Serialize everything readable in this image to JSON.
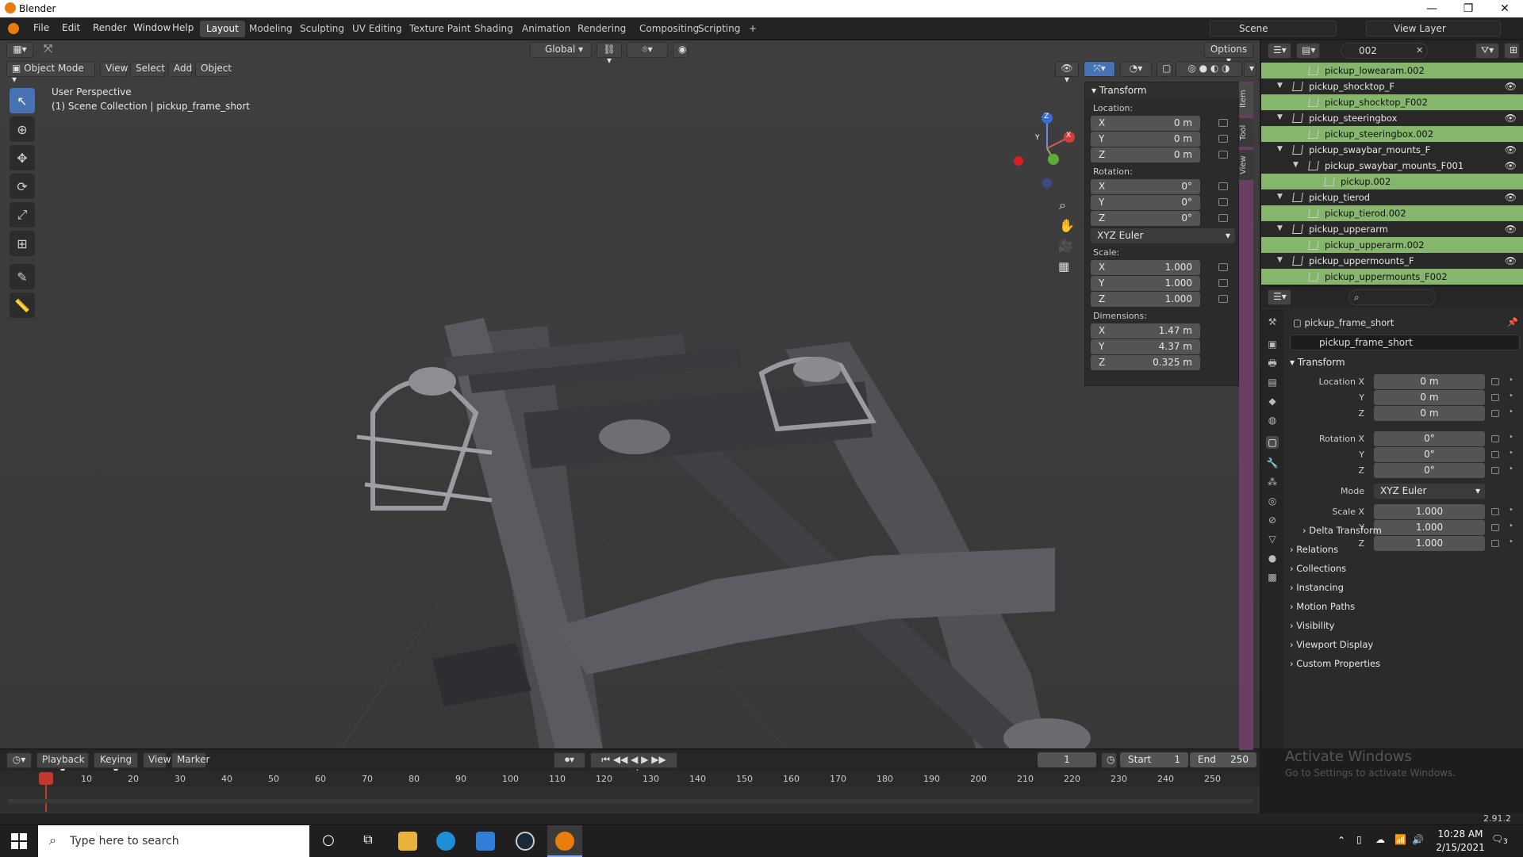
{
  "window": {
    "title": "Blender",
    "min": "—",
    "max": "❐",
    "close": "✕"
  },
  "menu": [
    "File",
    "Edit",
    "Render",
    "Window",
    "Help"
  ],
  "workspaces": [
    "Layout",
    "Modeling",
    "Sculpting",
    "UV Editing",
    "Texture Paint",
    "Shading",
    "Animation",
    "Rendering",
    "Compositing",
    "Scripting"
  ],
  "active_workspace": "Layout",
  "add_tab": "+",
  "scene": {
    "name": "Scene",
    "view_layer": "View Layer"
  },
  "viewport": {
    "transform_orientation": "Global",
    "options": "Options",
    "mode": "Object Mode",
    "header_menus": [
      "View",
      "Select",
      "Add",
      "Object"
    ],
    "overlay_line1": "User Perspective",
    "overlay_line2": "(1) Scene Collection | pickup_frame_short",
    "gizmo": {
      "x": "X",
      "y": "Y",
      "z": "Z"
    }
  },
  "npanel": {
    "title": "Transform",
    "location_label": "Location:",
    "location": [
      {
        "ax": "X",
        "v": "0 m"
      },
      {
        "ax": "Y",
        "v": "0 m"
      },
      {
        "ax": "Z",
        "v": "0 m"
      }
    ],
    "rotation_label": "Rotation:",
    "rotation": [
      {
        "ax": "X",
        "v": "0°"
      },
      {
        "ax": "Y",
        "v": "0°"
      },
      {
        "ax": "Z",
        "v": "0°"
      }
    ],
    "rotation_mode": "XYZ Euler",
    "scale_label": "Scale:",
    "scale": [
      {
        "ax": "X",
        "v": "1.000"
      },
      {
        "ax": "Y",
        "v": "1.000"
      },
      {
        "ax": "Z",
        "v": "1.000"
      }
    ],
    "dimensions_label": "Dimensions:",
    "dimensions": [
      {
        "ax": "X",
        "v": "1.47 m"
      },
      {
        "ax": "Y",
        "v": "4.37 m"
      },
      {
        "ax": "Z",
        "v": "0.325 m"
      }
    ],
    "tabs": [
      "Item",
      "Tool",
      "View"
    ]
  },
  "outliner": {
    "search": "002",
    "rows": [
      {
        "name": "pickup_lowearam.002",
        "child": true,
        "indent": 1
      },
      {
        "name": "pickup_shocktop_F",
        "child": false,
        "indent": 0
      },
      {
        "name": "pickup_shocktop_F002",
        "child": true,
        "indent": 1
      },
      {
        "name": "pickup_steeringbox",
        "child": false,
        "indent": 0
      },
      {
        "name": "pickup_steeringbox.002",
        "child": true,
        "indent": 1
      },
      {
        "name": "pickup_swaybar_mounts_F",
        "child": false,
        "indent": 0
      },
      {
        "name": "pickup_swaybar_mounts_F001",
        "child": false,
        "indent": 1
      },
      {
        "name": "pickup.002",
        "child": true,
        "indent": 2
      },
      {
        "name": "pickup_tierod",
        "child": false,
        "indent": 0
      },
      {
        "name": "pickup_tierod.002",
        "child": true,
        "indent": 1
      },
      {
        "name": "pickup_upperarm",
        "child": false,
        "indent": 0
      },
      {
        "name": "pickup_upperarm.002",
        "child": true,
        "indent": 1
      },
      {
        "name": "pickup_uppermounts_F",
        "child": false,
        "indent": 0
      },
      {
        "name": "pickup_uppermounts_F002",
        "child": true,
        "indent": 1
      }
    ]
  },
  "properties": {
    "object_name": "pickup_frame_short",
    "datablock": "pickup_frame_short",
    "transform_title": "Transform",
    "location": [
      {
        "l": "Location X",
        "v": "0 m"
      },
      {
        "l": "Y",
        "v": "0 m"
      },
      {
        "l": "Z",
        "v": "0 m"
      }
    ],
    "rotation": [
      {
        "l": "Rotation X",
        "v": "0°"
      },
      {
        "l": "Y",
        "v": "0°"
      },
      {
        "l": "Z",
        "v": "0°"
      }
    ],
    "mode_label": "Mode",
    "mode": "XYZ Euler",
    "scale": [
      {
        "l": "Scale X",
        "v": "1.000"
      },
      {
        "l": "Y",
        "v": "1.000"
      },
      {
        "l": "Z",
        "v": "1.000"
      }
    ],
    "delta": "Delta Transform",
    "sections": [
      "Relations",
      "Collections",
      "Instancing",
      "Motion Paths",
      "Visibility",
      "Viewport Display",
      "Custom Properties"
    ],
    "watermark1": "Activate Windows",
    "watermark2": "Go to Settings to activate Windows."
  },
  "timeline": {
    "menus": [
      "Playback",
      "Keying",
      "View",
      "Marker"
    ],
    "current_frame": "1",
    "start_label": "Start",
    "start": "1",
    "end_label": "End",
    "end": "250",
    "ticks": [
      "1",
      "10",
      "20",
      "30",
      "40",
      "50",
      "60",
      "70",
      "80",
      "90",
      "100",
      "110",
      "120",
      "130",
      "140",
      "150",
      "160",
      "170",
      "180",
      "190",
      "200",
      "210",
      "220",
      "230",
      "240",
      "250"
    ]
  },
  "status": {
    "version": "2.91.2"
  },
  "taskbar": {
    "search_placeholder": "Type here to search",
    "time": "10:28 AM",
    "date": "2/15/2021",
    "notifications": "3"
  }
}
